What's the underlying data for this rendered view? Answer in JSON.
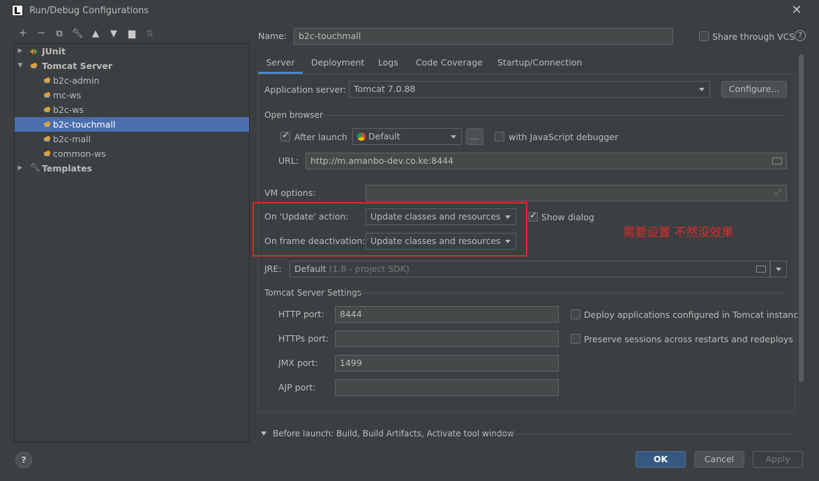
{
  "window": {
    "title": "Run/Debug Configurations"
  },
  "tree": {
    "groups": [
      {
        "label": "JUnit"
      },
      {
        "label": "Tomcat Server"
      },
      {
        "label": "Templates"
      }
    ],
    "items": [
      "b2c-admin",
      "mc-ws",
      "b2c-ws",
      "b2c-touchmall",
      "b2c-mall",
      "common-ws"
    ]
  },
  "name": {
    "label": "Name:",
    "value": "b2c-touchmall"
  },
  "share": {
    "label": "Share through VCS"
  },
  "tabs": [
    "Server",
    "Deployment",
    "Logs",
    "Code Coverage",
    "Startup/Connection"
  ],
  "server": {
    "app_server_label": "Application server:",
    "app_server_value": "Tomcat 7.0.88",
    "configure_label": "Configure...",
    "open_browser_label": "Open browser",
    "after_launch_label": "After launch",
    "browser_value": "Default",
    "browse_btn": "...",
    "js_debugger_label": "with JavaScript debugger",
    "url_label": "URL:",
    "url_value": "http://m.amanbo-dev.co.ke:8444",
    "vm_label": "VM options:",
    "update_label": "On 'Update' action:",
    "update_value": "Update classes and resources",
    "show_dialog_label": "Show dialog",
    "deactivation_label": "On frame deactivation:",
    "deactivation_value": "Update classes and resources",
    "jre_label": "JRE:",
    "jre_value": "Default",
    "jre_hint": "(1.8 - project SDK)",
    "tomcat_settings_label": "Tomcat Server Settings",
    "http_label": "HTTP port:",
    "http_value": "8444",
    "https_label": "HTTPs port:",
    "https_value": "",
    "jmx_label": "JMX port:",
    "jmx_value": "1499",
    "ajp_label": "AJP port:",
    "ajp_value": "",
    "deploy_label": "Deploy applications configured in Tomcat instance",
    "preserve_label": "Preserve sessions across restarts and redeploys"
  },
  "annotation": "需要设置 不然没效果",
  "before_launch": "Before launch: Build, Build Artifacts, Activate tool window",
  "buttons": {
    "ok": "OK",
    "cancel": "Cancel",
    "apply": "Apply",
    "help": "?"
  },
  "colors": {
    "selection": "#4b6eaf",
    "annotation": "#e0282a",
    "primary_button": "#365880"
  }
}
